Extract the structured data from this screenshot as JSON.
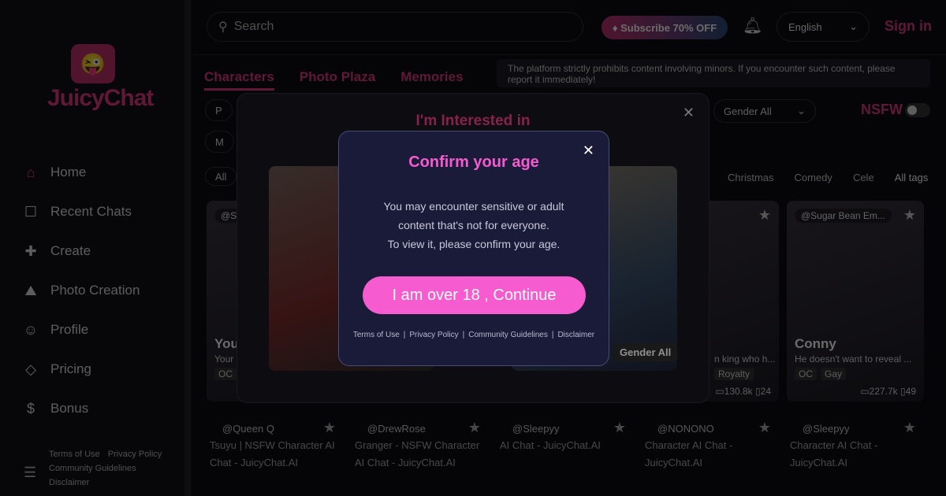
{
  "sidebar": {
    "logo": "JuicyChat",
    "items": [
      {
        "label": "Home",
        "icon": "home-icon"
      },
      {
        "label": "Recent Chats",
        "icon": "chat-icon"
      },
      {
        "label": "Create",
        "icon": "create-icon"
      },
      {
        "label": "Photo Creation",
        "icon": "photo-icon"
      },
      {
        "label": "Profile",
        "icon": "user-icon"
      },
      {
        "label": "Pricing",
        "icon": "diamond-icon"
      },
      {
        "label": "Bonus",
        "icon": "coin-icon"
      }
    ],
    "footer": [
      "Terms of Use",
      "Privacy Policy",
      "Community Guidelines",
      "Disclaimer"
    ]
  },
  "header": {
    "search_placeholder": "Search",
    "subscribe": "Subscribe 70% OFF",
    "language": "English",
    "signin": "Sign in"
  },
  "notice": "The platform strictly prohibits content involving minors. If you encounter such content, please report it immediately!",
  "tabs": [
    "Characters",
    "Photo Plaza",
    "Memories"
  ],
  "filters": {
    "pill1": "P",
    "pill2": "M",
    "all": "All",
    "gender": "Gender All",
    "nsfw": "NSFW",
    "nsfw_on": false,
    "tags": [
      "Christmas",
      "Comedy",
      "Cele",
      "All tags"
    ]
  },
  "cards": [
    {
      "author": "@S",
      "name": "You",
      "desc": "Your",
      "tags": [
        "OC"
      ],
      "chats": "",
      "saves": ""
    },
    {
      "author": "",
      "name": "",
      "desc": "",
      "tags": [],
      "chats": "",
      "saves": ""
    },
    {
      "author": "",
      "name": "",
      "desc": "",
      "tags": [],
      "chats": "",
      "saves": ""
    },
    {
      "author": "",
      "name": "",
      "desc": "n king who h...",
      "tags": [
        "Royalty"
      ],
      "chats": "130.8k",
      "saves": "24"
    },
    {
      "author": "@Sugar Bean Em...",
      "name": "Conny",
      "desc": "He doesn't want to reveal ...",
      "tags": [
        "OC",
        "Gay"
      ],
      "chats": "227.7k",
      "saves": "49"
    }
  ],
  "cards2": [
    {
      "author": "@Queen Q",
      "title": "Tsuyu | NSFW Character AI Chat - JuicyChat.AI"
    },
    {
      "author": "@DrewRose",
      "title": "Granger - NSFW Character AI Chat - JuicyChat.AI"
    },
    {
      "author": "@Sleepyy",
      "title": "AI Chat - JuicyChat.AI"
    },
    {
      "author": "@NONONO",
      "title": "Character AI Chat - JuicyChat.AI"
    },
    {
      "author": "@Sleepyy",
      "title": "Character AI Chat - JuicyChat.AI"
    }
  ],
  "interest_modal": {
    "title": "I'm Interested in",
    "gender_tag": "Gender All"
  },
  "age_modal": {
    "title": "Confirm your age",
    "line1": "You may encounter sensitive or adult",
    "line2": "content that's not for everyone.",
    "line3": "To view it, please confirm your age.",
    "button": "I am over 18 , Continue",
    "links": [
      "Terms of Use",
      "Privacy Policy",
      "Community Guidelines",
      "Disclaimer"
    ]
  },
  "colors": {
    "accent": "#f75bd0",
    "brand": "#e2397f",
    "modal_bg": "#1a1b38"
  }
}
